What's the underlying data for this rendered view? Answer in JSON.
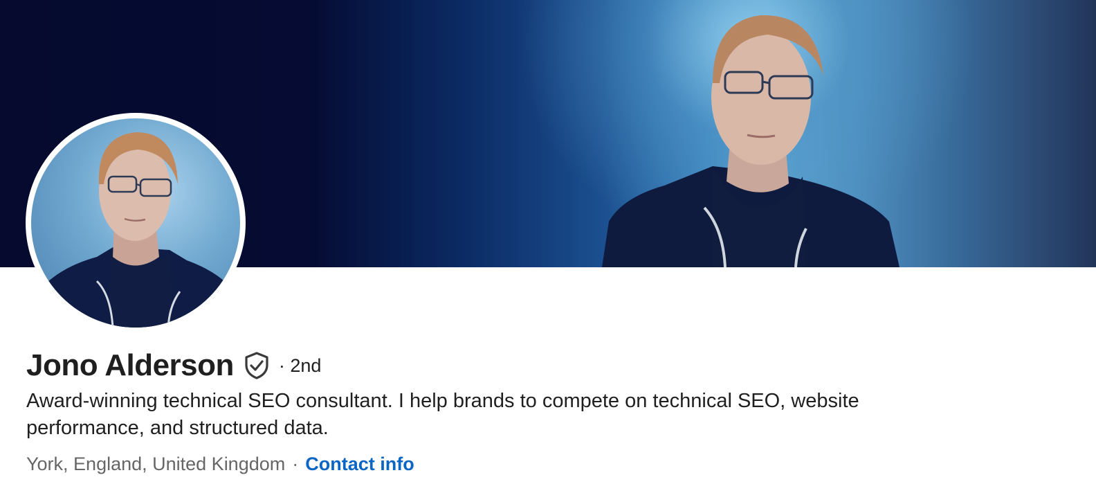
{
  "profile": {
    "name": "Jono Alderson",
    "verified_icon": "verified-shield-icon",
    "degree": "· 2nd",
    "headline": "Award-winning technical SEO consultant. I help brands to compete on technical SEO, website performance, and structured data.",
    "location": "York, England, United Kingdom",
    "separator": "·",
    "contact_info_label": "Contact info"
  },
  "colors": {
    "link": "#0a66c2",
    "secondary_text": "#666666",
    "primary_text": "#1f1f1f",
    "cover_dark": "#050a2e",
    "cover_light": "#5da6d3"
  }
}
